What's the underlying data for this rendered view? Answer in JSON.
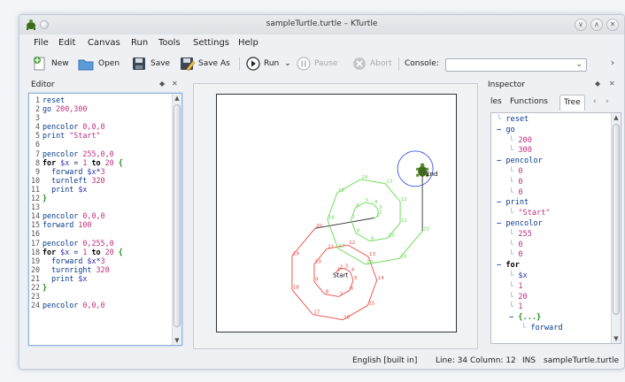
{
  "window": {
    "title": "sampleTurtle.turtle – KTurtle",
    "controls": {
      "minimize": "∨",
      "maximize": "∧",
      "close": "✕"
    }
  },
  "menu": [
    "File",
    "Edit",
    "Canvas",
    "Run",
    "Tools",
    "Settings",
    "Help"
  ],
  "toolbar": {
    "new_label": "New",
    "open_label": "Open",
    "save_label": "Save",
    "save_as_label": "Save As",
    "run_label": "Run",
    "pause_label": "Pause",
    "abort_label": "Abort",
    "console_label": "Console:",
    "console_value": "",
    "more": "›"
  },
  "editor": {
    "title": "Editor",
    "lines": [
      {
        "n": "1",
        "tokens": [
          [
            "cmd",
            "reset"
          ]
        ]
      },
      {
        "n": "2",
        "tokens": [
          [
            "cmd",
            "go "
          ],
          [
            "num",
            "200,300"
          ]
        ]
      },
      {
        "n": "3",
        "tokens": []
      },
      {
        "n": "4",
        "tokens": [
          [
            "cmd",
            "pencolor "
          ],
          [
            "num",
            "0,0,0"
          ]
        ]
      },
      {
        "n": "5",
        "tokens": [
          [
            "cmd",
            "print "
          ],
          [
            "str",
            "\"Start\""
          ]
        ]
      },
      {
        "n": "6",
        "tokens": []
      },
      {
        "n": "7",
        "tokens": [
          [
            "cmd",
            "pencolor "
          ],
          [
            "num",
            "255,0,0"
          ]
        ]
      },
      {
        "n": "8",
        "tokens": [
          [
            "kw",
            "for "
          ],
          [
            "var",
            "$x"
          ],
          [
            "plain",
            " = "
          ],
          [
            "num",
            "1"
          ],
          [
            "kw",
            " to "
          ],
          [
            "num",
            "20"
          ],
          [
            "brace",
            " {"
          ]
        ]
      },
      {
        "n": "9",
        "tokens": [
          [
            "cmd",
            "  forward "
          ],
          [
            "var",
            "$x"
          ],
          [
            "plain",
            "*"
          ],
          [
            "num",
            "3"
          ]
        ]
      },
      {
        "n": "10",
        "tokens": [
          [
            "cmd",
            "  turnleft "
          ],
          [
            "num",
            "320"
          ]
        ]
      },
      {
        "n": "11",
        "tokens": [
          [
            "cmd",
            "  print "
          ],
          [
            "var",
            "$x"
          ]
        ]
      },
      {
        "n": "12",
        "tokens": [
          [
            "brace",
            "}"
          ]
        ]
      },
      {
        "n": "13",
        "tokens": []
      },
      {
        "n": "14",
        "tokens": [
          [
            "cmd",
            "pencolor "
          ],
          [
            "num",
            "0,0,0"
          ]
        ]
      },
      {
        "n": "15",
        "tokens": [
          [
            "cmd",
            "forward "
          ],
          [
            "num",
            "100"
          ]
        ]
      },
      {
        "n": "16",
        "tokens": []
      },
      {
        "n": "17",
        "tokens": [
          [
            "cmd",
            "pencolor "
          ],
          [
            "num",
            "0,255,0"
          ]
        ]
      },
      {
        "n": "18",
        "tokens": [
          [
            "kw",
            "for "
          ],
          [
            "var",
            "$x"
          ],
          [
            "plain",
            " = "
          ],
          [
            "num",
            "1"
          ],
          [
            "kw",
            " to "
          ],
          [
            "num",
            "20"
          ],
          [
            "brace",
            " {"
          ]
        ]
      },
      {
        "n": "19",
        "tokens": [
          [
            "cmd",
            "  forward "
          ],
          [
            "var",
            "$x"
          ],
          [
            "plain",
            "*"
          ],
          [
            "num",
            "3"
          ]
        ]
      },
      {
        "n": "20",
        "tokens": [
          [
            "cmd",
            "  turnright "
          ],
          [
            "num",
            "320"
          ]
        ]
      },
      {
        "n": "21",
        "tokens": [
          [
            "cmd",
            "  print "
          ],
          [
            "var",
            "$x"
          ]
        ]
      },
      {
        "n": "22",
        "tokens": [
          [
            "brace",
            "}"
          ]
        ]
      },
      {
        "n": "23",
        "tokens": []
      },
      {
        "n": "24",
        "tokens": [
          [
            "cmd",
            "pencolor "
          ],
          [
            "num",
            "0,0,0"
          ]
        ]
      }
    ]
  },
  "canvas": {
    "start_label": "Start",
    "end_label": "End"
  },
  "inspector": {
    "title": "Inspector",
    "tabs": [
      "les",
      "Functions",
      "Tree"
    ],
    "active_tab": "Tree",
    "tree": [
      {
        "depth": 0,
        "exp": "",
        "cls": "cmd",
        "text": "reset"
      },
      {
        "depth": 0,
        "exp": "−",
        "cls": "cmd",
        "text": "go"
      },
      {
        "depth": 1,
        "exp": "",
        "cls": "val",
        "text": "200"
      },
      {
        "depth": 1,
        "exp": "",
        "cls": "val",
        "text": "300"
      },
      {
        "depth": 0,
        "exp": "−",
        "cls": "cmd",
        "text": "pencolor"
      },
      {
        "depth": 1,
        "exp": "",
        "cls": "val",
        "text": "0"
      },
      {
        "depth": 1,
        "exp": "",
        "cls": "val",
        "text": "0"
      },
      {
        "depth": 1,
        "exp": "",
        "cls": "val",
        "text": "0"
      },
      {
        "depth": 0,
        "exp": "−",
        "cls": "cmd",
        "text": "print"
      },
      {
        "depth": 1,
        "exp": "",
        "cls": "val",
        "text": "\"Start\""
      },
      {
        "depth": 0,
        "exp": "−",
        "cls": "cmd",
        "text": "pencolor"
      },
      {
        "depth": 1,
        "exp": "",
        "cls": "val",
        "text": "255"
      },
      {
        "depth": 1,
        "exp": "",
        "cls": "val",
        "text": "0"
      },
      {
        "depth": 1,
        "exp": "",
        "cls": "val",
        "text": "0"
      },
      {
        "depth": 0,
        "exp": "−",
        "cls": "kw",
        "text": "for"
      },
      {
        "depth": 1,
        "exp": "",
        "cls": "var",
        "text": "$x"
      },
      {
        "depth": 1,
        "exp": "",
        "cls": "val",
        "text": "1"
      },
      {
        "depth": 1,
        "exp": "",
        "cls": "val",
        "text": "20"
      },
      {
        "depth": 1,
        "exp": "",
        "cls": "val",
        "text": "1"
      },
      {
        "depth": 1,
        "exp": "−",
        "cls": "brace",
        "text": "{...}"
      },
      {
        "depth": 2,
        "exp": "",
        "cls": "cmd",
        "text": "forward"
      }
    ]
  },
  "statusbar": {
    "language": "English [built in]",
    "position": "Line: 34 Column: 12",
    "mode": "INS",
    "file": "sampleTurtle.turtle"
  },
  "colors": {
    "red_path": "#e8483f",
    "green_path": "#62d94a",
    "blue_circle": "#4255e0",
    "keyword": "#000000",
    "number": "#c02d7d",
    "variable": "#3333b0",
    "command": "#0b3a8a"
  }
}
